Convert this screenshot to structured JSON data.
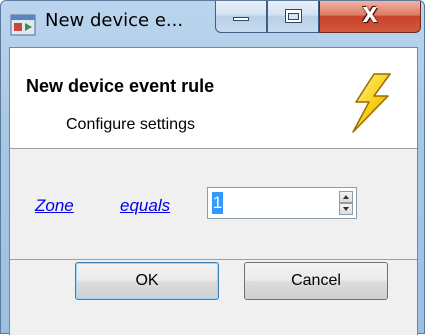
{
  "window": {
    "title": "New device e...",
    "close_glyph": "X",
    "icons": {
      "app": "app-window-icon",
      "header": "lightning-bolt-icon"
    }
  },
  "header": {
    "title": "New device event rule",
    "subtitle": "Configure settings"
  },
  "rule": {
    "field_link": "Zone",
    "operator_link": "equals",
    "value": "1"
  },
  "buttons": {
    "ok_label": "OK",
    "cancel_label": "Cancel"
  },
  "colors": {
    "link": "#0000ee",
    "selection": "#3399ff",
    "close_button": "#c7432a"
  }
}
